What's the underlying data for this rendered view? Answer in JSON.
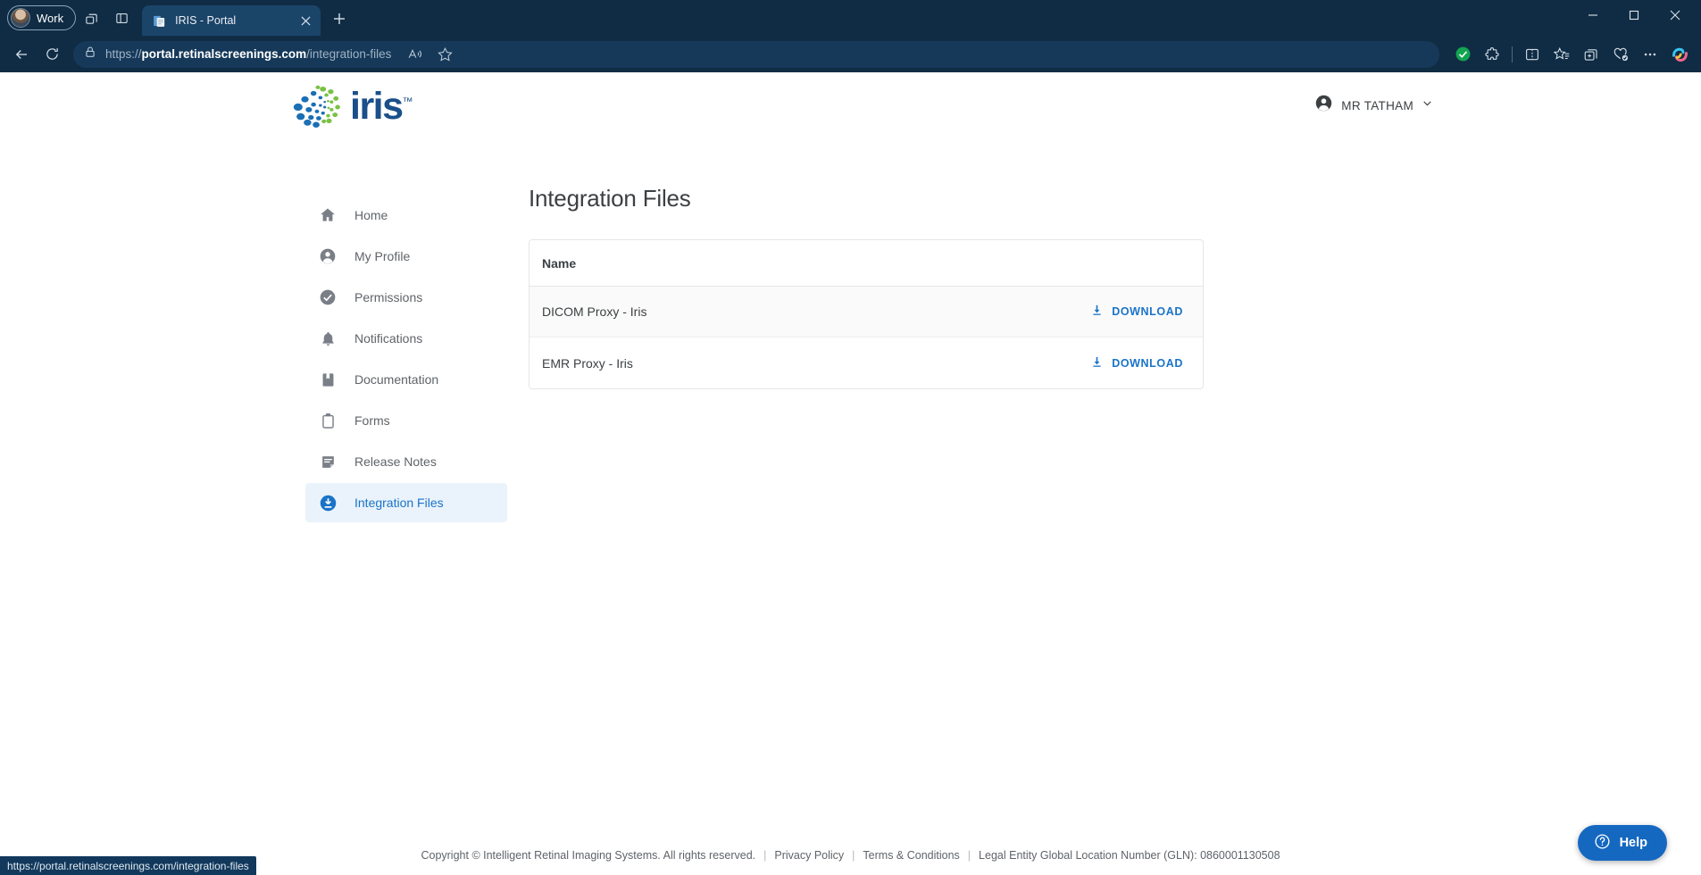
{
  "browser": {
    "profile_label": "Work",
    "tab": {
      "title": "IRIS - Portal",
      "favicon": "document-icon",
      "close": "close-icon"
    },
    "newtab_label": "+",
    "window_controls": {
      "minimize": "—",
      "maximize": "□",
      "close": "✕"
    },
    "nav": {
      "back": "back-arrow-icon",
      "reload": "reload-icon"
    },
    "address": {
      "lock": "lock-icon",
      "scheme": "https://",
      "host": "portal.retinalscreenings.com",
      "path": "/integration-files",
      "read_aloud": "read-aloud-icon",
      "favorite": "star-icon"
    },
    "toolbar_icons": [
      "verified-check-icon",
      "extensions-icon",
      "split-screen-icon",
      "favorites-list-icon",
      "add-collection-icon",
      "browser-essentials-icon",
      "more-options-icon",
      "copilot-icon"
    ],
    "status_link": "https://portal.retinalscreenings.com/integration-files"
  },
  "site": {
    "logo_text": "iris",
    "logo_tm": "™",
    "user": {
      "name": "MR TATHAM",
      "avatar_icon": "account-circle-icon",
      "chevron": "chevron-down-icon"
    }
  },
  "sidebar": {
    "items": [
      {
        "label": "Home",
        "icon": "home-icon",
        "active": false
      },
      {
        "label": "My Profile",
        "icon": "account-circle-icon",
        "active": false
      },
      {
        "label": "Permissions",
        "icon": "check-circle-icon",
        "active": false
      },
      {
        "label": "Notifications",
        "icon": "bell-icon",
        "active": false
      },
      {
        "label": "Documentation",
        "icon": "book-icon",
        "active": false
      },
      {
        "label": "Forms",
        "icon": "clipboard-icon",
        "active": false
      },
      {
        "label": "Release Notes",
        "icon": "note-icon",
        "active": false
      },
      {
        "label": "Integration Files",
        "icon": "download-circle-icon",
        "active": true
      }
    ]
  },
  "main": {
    "title": "Integration Files",
    "table": {
      "columns": [
        "Name"
      ],
      "rows": [
        {
          "name": "DICOM Proxy - Iris",
          "action": "DOWNLOAD",
          "action_icon": "download-icon"
        },
        {
          "name": "EMR Proxy - Iris",
          "action": "DOWNLOAD",
          "action_icon": "download-icon"
        }
      ]
    }
  },
  "footer": {
    "copyright": "Copyright © Intelligent Retinal Imaging Systems. All rights reserved.",
    "sep": "|",
    "privacy": "Privacy Policy",
    "terms": "Terms & Conditions",
    "gln": "Legal Entity Global Location Number (GLN): 0860001130508"
  },
  "help": {
    "label": "Help",
    "icon": "question-circle-icon"
  },
  "colors": {
    "brand_blue": "#1b4f8a",
    "brand_green": "#7ac143",
    "accent": "#1a73c8",
    "chrome_bg": "#102c44"
  }
}
